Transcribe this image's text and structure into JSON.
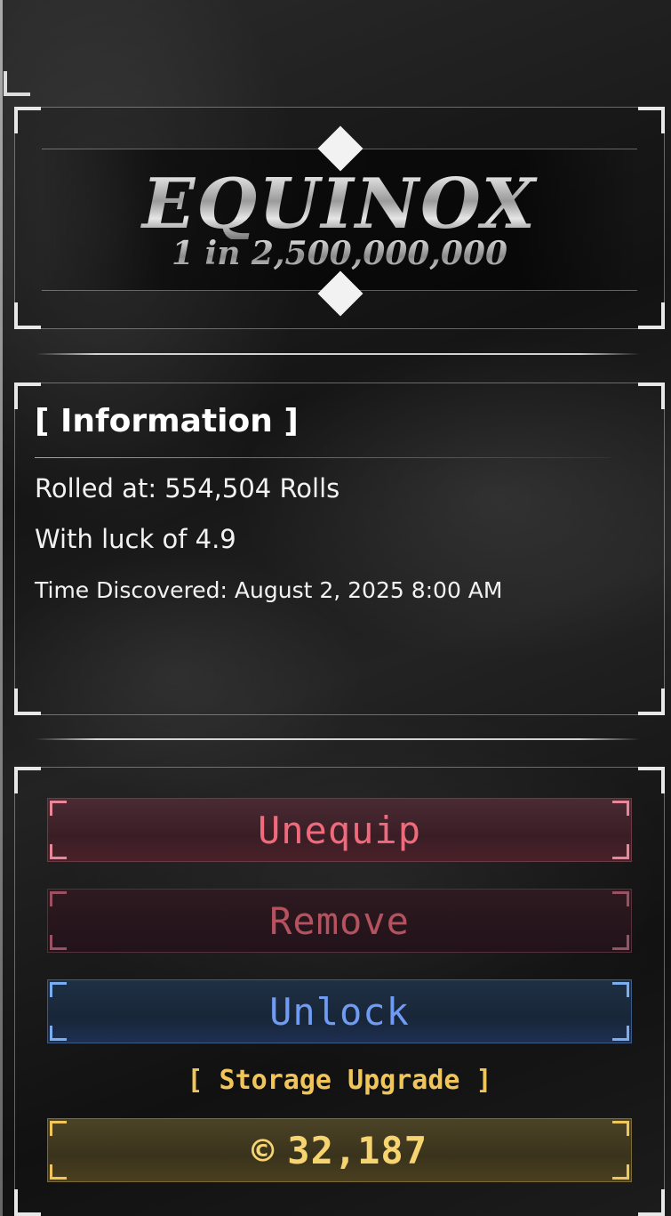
{
  "rarity": {
    "name": "EQUINOX",
    "chance": "1 in 2,500,000,000"
  },
  "information": {
    "title": "[ Information ]",
    "rolled_at": "Rolled at: 554,504 Rolls",
    "luck": "With luck of 4.9",
    "time_discovered": "Time Discovered: August 2, 2025 8:00 AM"
  },
  "actions": {
    "unequip_label": "Unequip",
    "remove_label": "Remove",
    "unlock_label": "Unlock",
    "storage_upgrade_label": "[ Storage Upgrade ]",
    "cost_icon": "©",
    "cost_value": "32,187"
  },
  "colors": {
    "unequip": "#f06a7c",
    "remove": "#b5525f",
    "unlock": "#6f9bf2",
    "storage": "#f0c65a"
  },
  "icons": {
    "cost": "coin-icon",
    "title_top": "diamond-up-icon",
    "title_bottom": "diamond-down-icon"
  }
}
